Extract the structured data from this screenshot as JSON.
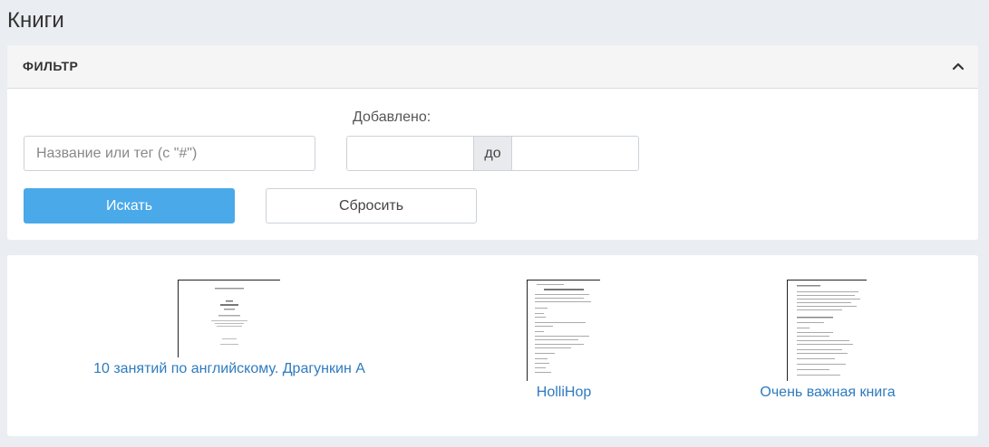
{
  "page": {
    "title": "Книги"
  },
  "filter": {
    "header": "ФИЛЬТР",
    "added_label": "Добавлено:",
    "search_placeholder": "Название или тег (с \"#\")",
    "date_separator": "до",
    "search_button": "Искать",
    "reset_button": "Сбросить"
  },
  "books": [
    {
      "title": "10 занятий по английскому. Драгункин А"
    },
    {
      "title": "HolliHop"
    },
    {
      "title": "Очень важная книга"
    }
  ],
  "colors": {
    "accent": "#4aa9e8",
    "link": "#2e7bbf",
    "background": "#eaedf1"
  },
  "icons": {
    "collapse": "chevron-up-icon"
  }
}
